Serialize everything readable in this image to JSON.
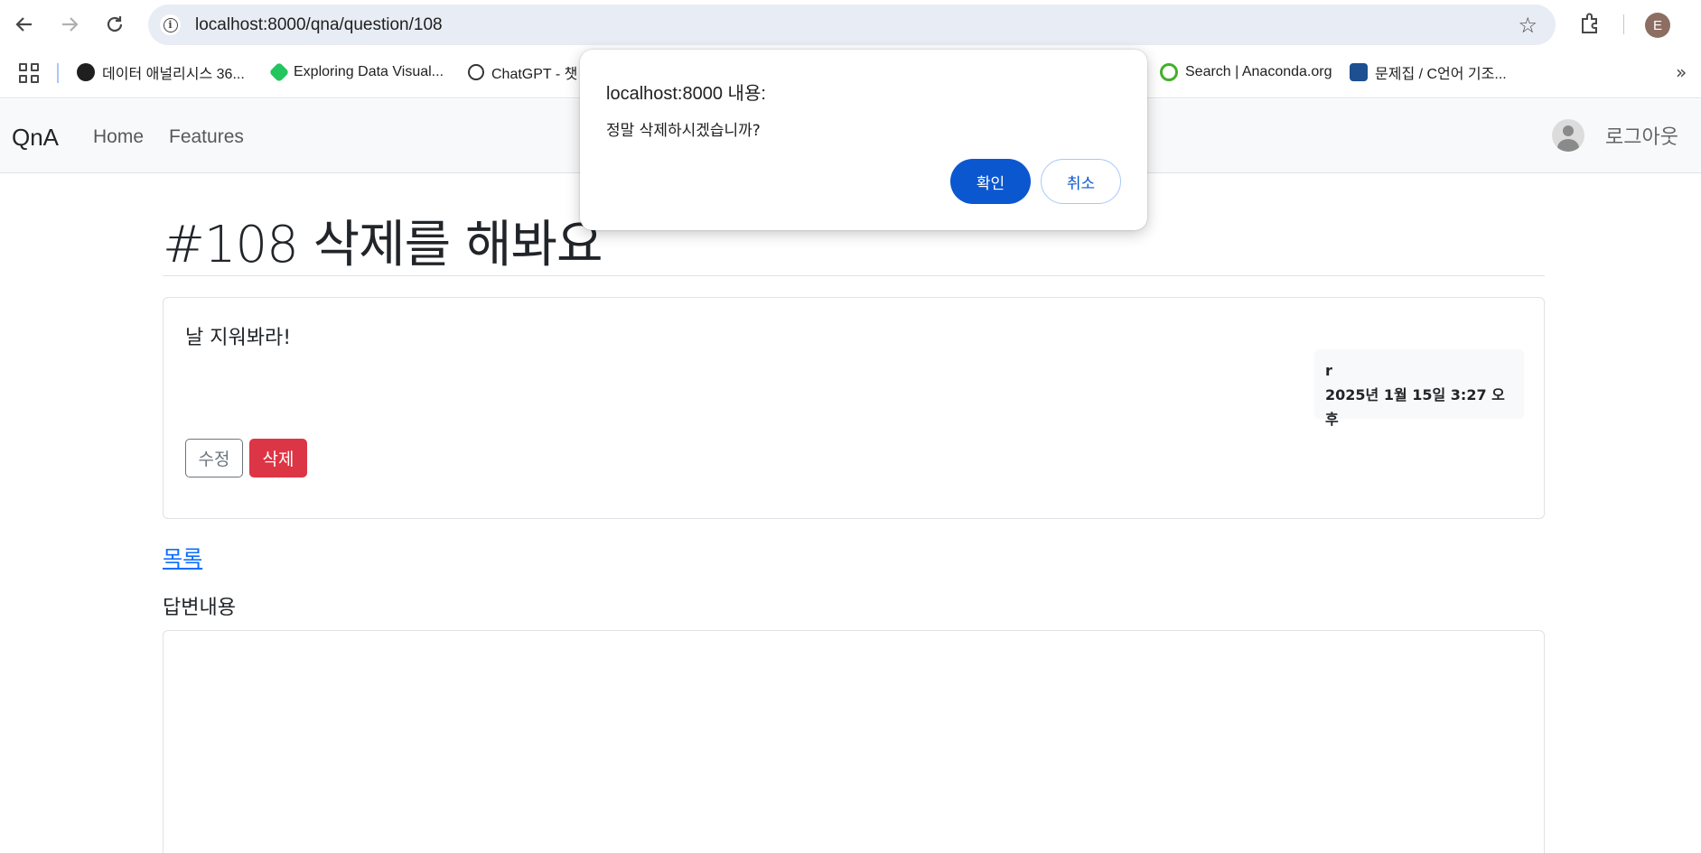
{
  "browser": {
    "url": "localhost:8000/qna/question/108",
    "profile_initial": "E",
    "bookmarks": [
      {
        "label": "데이터 애널리시스 36..."
      },
      {
        "label": "Exploring Data Visual..."
      },
      {
        "label": "ChatGPT - 챗"
      },
      {
        "label": "Search | Anaconda.org"
      },
      {
        "label": "문제집 / C언어 기조..."
      }
    ]
  },
  "navbar": {
    "brand": "QnA",
    "home": "Home",
    "features": "Features",
    "logout": "로그아웃"
  },
  "question": {
    "title": "#108 삭제를 해봐요",
    "content": "날 지워봐라!",
    "author": "r",
    "date": "2025년 1월 15일 3:27 오후",
    "edit_label": "수정",
    "delete_label": "삭제"
  },
  "page": {
    "list_link": "목록",
    "answer_label": "답변내용"
  },
  "dialog": {
    "title": "localhost:8000 내용:",
    "message": "정말 삭제하시겠습니까?",
    "ok_label": "확인",
    "cancel_label": "취소"
  },
  "colors": {
    "primary": "#0d6efd",
    "danger": "#dc3545",
    "dialog_primary": "#0b57d0"
  }
}
